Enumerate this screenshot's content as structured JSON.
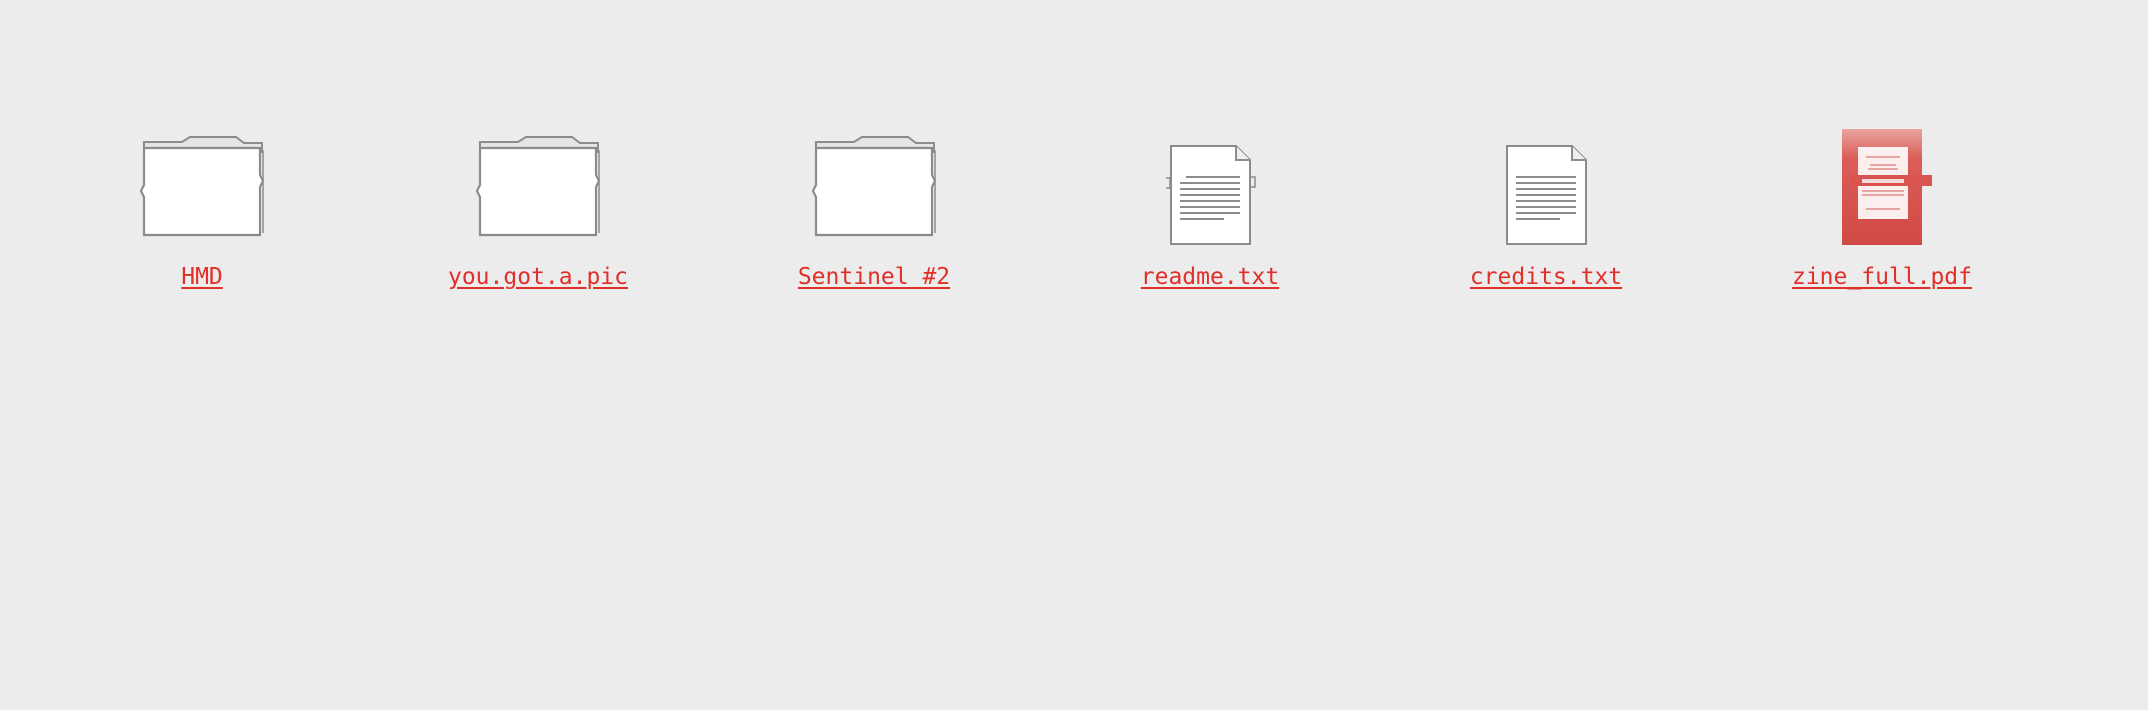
{
  "colors": {
    "background": "#ececec",
    "link": "#e0302a",
    "icon_stroke": "#8c8c8c",
    "pdf_cover": "#d9534f"
  },
  "items": [
    {
      "label": "HMD",
      "type": "folder",
      "icon": "folder-icon"
    },
    {
      "label": "you.got.a.pic",
      "type": "folder",
      "icon": "folder-icon"
    },
    {
      "label": "Sentinel #2",
      "type": "folder",
      "icon": "folder-icon"
    },
    {
      "label": "readme.txt",
      "type": "text-file",
      "icon": "text-file-icon"
    },
    {
      "label": "credits.txt",
      "type": "text-file",
      "icon": "text-file-icon"
    },
    {
      "label": "zine_full.pdf",
      "type": "pdf-file",
      "icon": "pdf-thumbnail-icon"
    }
  ]
}
